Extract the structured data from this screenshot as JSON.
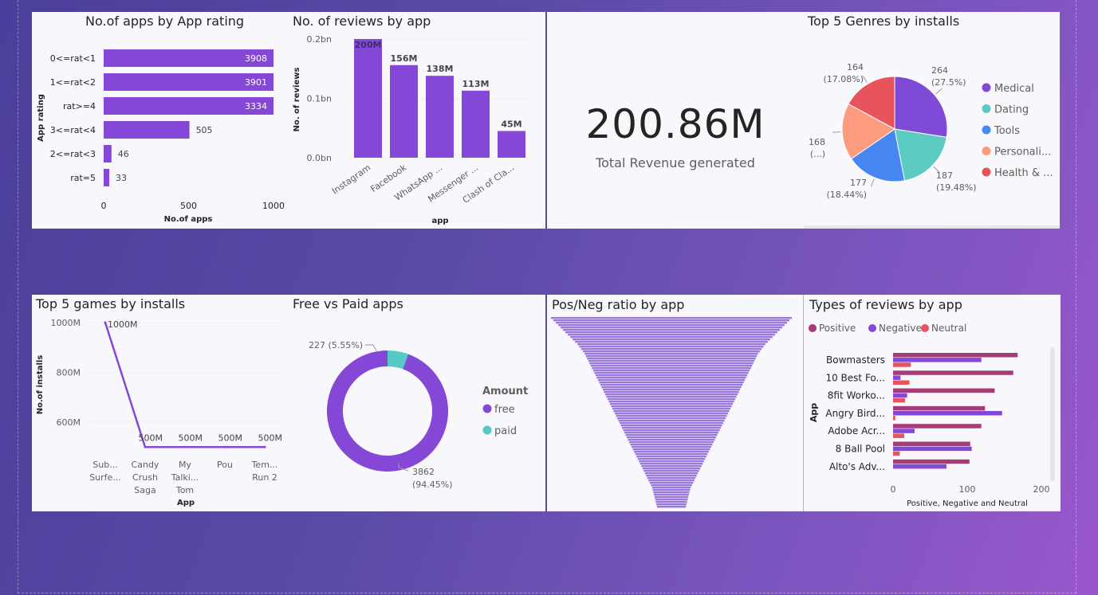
{
  "colors": {
    "purple": "#8548d6",
    "teal": "#55c9c5",
    "medical": "#7f4ad6",
    "dating": "#5bcbc4",
    "tools": "#4787f2",
    "personal": "#fd9b7e",
    "health": "#e8545b",
    "positive": "#a73b77",
    "negative": "#8548d6",
    "neutral": "#e8545b",
    "funnel": "#9a78dc"
  },
  "kpi": {
    "value": "200.86M",
    "label": "Total Revenue generated"
  },
  "rating_chart": {
    "title": "No.of apps by App rating",
    "xlabel": "No.of apps",
    "ylabel": "App rating",
    "x_ticks": [
      "0",
      "500",
      "1000"
    ]
  },
  "reviews_chart": {
    "title": "No. of reviews by app",
    "xlabel": "app",
    "ylabel": "No. of reviews",
    "y_ticks": [
      "0.2bn",
      "0.1bn",
      "0.0bn"
    ]
  },
  "genres_chart": {
    "title": "Top 5 Genres by installs"
  },
  "games_chart": {
    "title": "Top 5 games by installs",
    "xlabel": "App",
    "ylabel": "No.of installs",
    "y_ticks": [
      "1000M",
      "800M",
      "600M"
    ]
  },
  "freepaid_chart": {
    "title": "Free vs Paid apps",
    "legend_title": "Amount"
  },
  "ratio_chart": {
    "title": "Pos/Neg ratio by app"
  },
  "types_chart": {
    "title": "Types of reviews by app",
    "xlabel": "Positive, Negative and Neutral",
    "ylabel": "App",
    "x_ticks": [
      "0",
      "100",
      "200"
    ]
  },
  "chart_data": [
    {
      "type": "bar",
      "orientation": "horizontal",
      "title": "No.of apps by App rating",
      "xlabel": "No.of apps",
      "ylabel": "App rating",
      "categories": [
        "0<=rat<1",
        "1<=rat<2",
        "rat>=4",
        "3<=rat<4",
        "2<=rat<3",
        "rat=5"
      ],
      "values": [
        3908,
        3901,
        3334,
        505,
        46,
        33
      ],
      "labels": [
        "3908",
        "3901",
        "3334",
        "505",
        "46",
        "33"
      ],
      "xlim": [
        0,
        1000
      ]
    },
    {
      "type": "bar",
      "title": "No. of reviews by app",
      "xlabel": "app",
      "ylabel": "No. of reviews",
      "categories": [
        "Instagram",
        "Facebook",
        "WhatsApp ...",
        "Messenger ...",
        "Clash of Cla..."
      ],
      "values": [
        200,
        156,
        138,
        113,
        45
      ],
      "labels": [
        "200M",
        "156M",
        "138M",
        "113M",
        "45M"
      ],
      "ylim": [
        0,
        200
      ]
    },
    {
      "type": "pie",
      "title": "Top 5 Genres by installs",
      "categories": [
        "Medical",
        "Dating",
        "Tools",
        "Personali...",
        "Health & ..."
      ],
      "values": [
        264,
        187,
        177,
        168,
        164
      ],
      "labels": [
        {
          "value": "264",
          "pct": "(27.5%)"
        },
        {
          "value": "187",
          "pct": "(19.48%)"
        },
        {
          "value": "177",
          "pct": "(18.44%)"
        },
        {
          "value": "168",
          "pct": "(...)"
        },
        {
          "value": "164",
          "pct": "(17.08%)"
        }
      ]
    },
    {
      "type": "line",
      "title": "Top 5 games by installs",
      "xlabel": "App",
      "ylabel": "No.of installs",
      "categories": [
        [
          "Sub...",
          "Surfe..."
        ],
        [
          "Candy",
          "Crush",
          "Saga"
        ],
        [
          "My",
          "Talki...",
          "Tom"
        ],
        [
          "Pou"
        ],
        [
          "Tem...",
          "Run 2"
        ]
      ],
      "values": [
        1000,
        500,
        500,
        500,
        500
      ],
      "labels": [
        "1000M",
        "500M",
        "500M",
        "500M",
        "500M"
      ],
      "ylim": [
        500,
        1000
      ]
    },
    {
      "type": "pie",
      "subtype": "donut",
      "title": "Free vs Paid apps",
      "legend_title": "Amount",
      "categories": [
        "free",
        "paid"
      ],
      "values": [
        3862,
        227
      ],
      "labels": [
        "3862\n(94.45%)",
        "227 (5.55%)"
      ]
    },
    {
      "type": "bar",
      "subtype": "funnel",
      "title": "Pos/Neg ratio by app",
      "values_relative": [
        1.0,
        0.98,
        0.96,
        0.94,
        0.92,
        0.9,
        0.88,
        0.86,
        0.84,
        0.82,
        0.8,
        0.78,
        0.765,
        0.75,
        0.735,
        0.72,
        0.71,
        0.7,
        0.69,
        0.68,
        0.67,
        0.66,
        0.65,
        0.64,
        0.63,
        0.62,
        0.61,
        0.6,
        0.59,
        0.58,
        0.57,
        0.56,
        0.55,
        0.54,
        0.53,
        0.52,
        0.51,
        0.5,
        0.49,
        0.48,
        0.47,
        0.46,
        0.45,
        0.44,
        0.43,
        0.42,
        0.41,
        0.4,
        0.39,
        0.38,
        0.37,
        0.36,
        0.35,
        0.34,
        0.33,
        0.32,
        0.31,
        0.3,
        0.29,
        0.28,
        0.27,
        0.26,
        0.25,
        0.24,
        0.23,
        0.22,
        0.21,
        0.2,
        0.19,
        0.18,
        0.17,
        0.16,
        0.155,
        0.15,
        0.145,
        0.14,
        0.135,
        0.13,
        0.125,
        0.12
      ]
    },
    {
      "type": "bar",
      "orientation": "horizontal",
      "title": "Types of reviews by app",
      "xlabel": "Positive, Negative and Neutral",
      "ylabel": "App",
      "categories": [
        "Bowmasters",
        "10 Best Fo...",
        "8fit Worko...",
        "Angry Bird...",
        "Adobe Acr...",
        "8 Ball Pool",
        "Alto's Adv..."
      ],
      "series": [
        {
          "name": "Positive",
          "values": [
            168,
            162,
            137,
            124,
            119,
            104,
            103
          ]
        },
        {
          "name": "Negative",
          "values": [
            119,
            10,
            19,
            147,
            29,
            106,
            72
          ]
        },
        {
          "name": "Neutral",
          "values": [
            24,
            22,
            16,
            3,
            15,
            9,
            0
          ]
        }
      ],
      "xlim": [
        0,
        200
      ]
    }
  ]
}
